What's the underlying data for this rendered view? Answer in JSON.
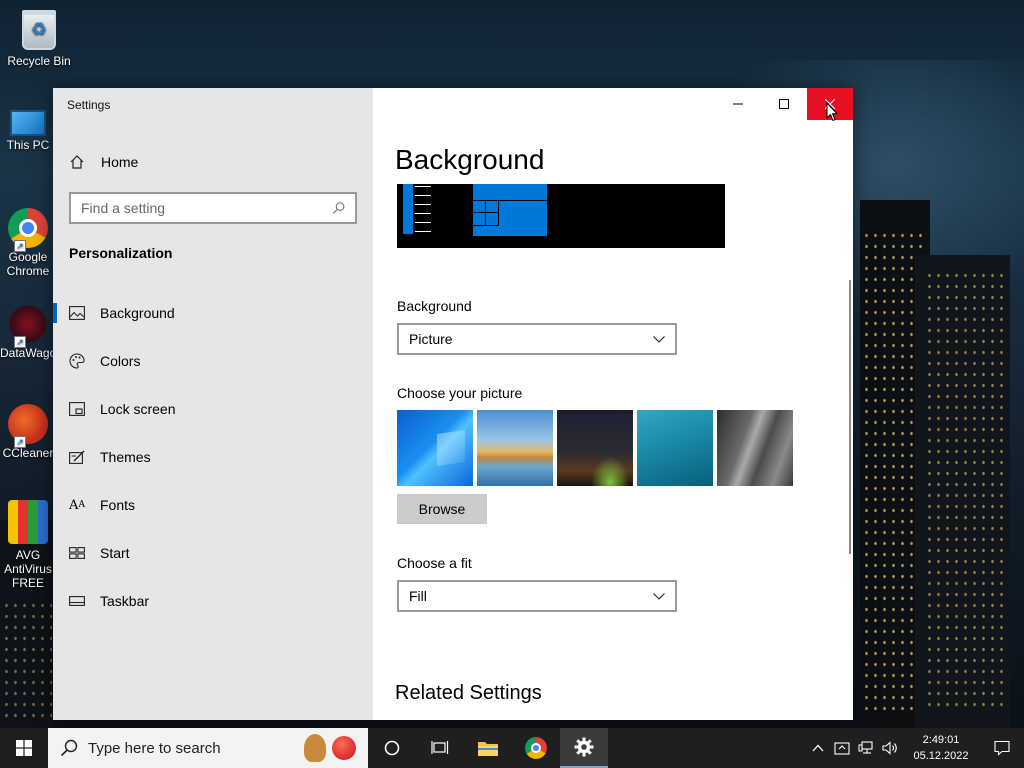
{
  "desktop": {
    "icons": [
      {
        "label": "Recycle Bin"
      },
      {
        "label": "This PC"
      },
      {
        "label": "Google Chrome"
      },
      {
        "label": "DataWagon"
      },
      {
        "label": "CCleaner"
      },
      {
        "label": "AVG AntiVirus FREE"
      }
    ]
  },
  "window": {
    "title": "Settings",
    "sidebar": {
      "home_label": "Home",
      "search_placeholder": "Find a setting",
      "section_title": "Personalization",
      "items": [
        {
          "label": "Background",
          "icon": "picture-icon",
          "active": true
        },
        {
          "label": "Colors",
          "icon": "palette-icon"
        },
        {
          "label": "Lock screen",
          "icon": "lock-screen-icon"
        },
        {
          "label": "Themes",
          "icon": "themes-icon"
        },
        {
          "label": "Fonts",
          "icon": "fonts-icon"
        },
        {
          "label": "Start",
          "icon": "start-icon"
        },
        {
          "label": "Taskbar",
          "icon": "taskbar-icon"
        }
      ]
    },
    "content": {
      "page_title": "Background",
      "background_label": "Background",
      "background_value": "Picture",
      "choose_picture_label": "Choose your picture",
      "browse_label": "Browse",
      "choose_fit_label": "Choose a fit",
      "fit_value": "Fill",
      "related_title": "Related Settings"
    }
  },
  "taskbar": {
    "search_placeholder": "Type here to search",
    "time": "2:49:01",
    "date": "05.12.2022"
  },
  "colors": {
    "accent": "#0078d7",
    "close_red": "#e81123",
    "sidebar_bg": "#e6e6e6",
    "taskbar_bg": "#1f1f1f"
  }
}
